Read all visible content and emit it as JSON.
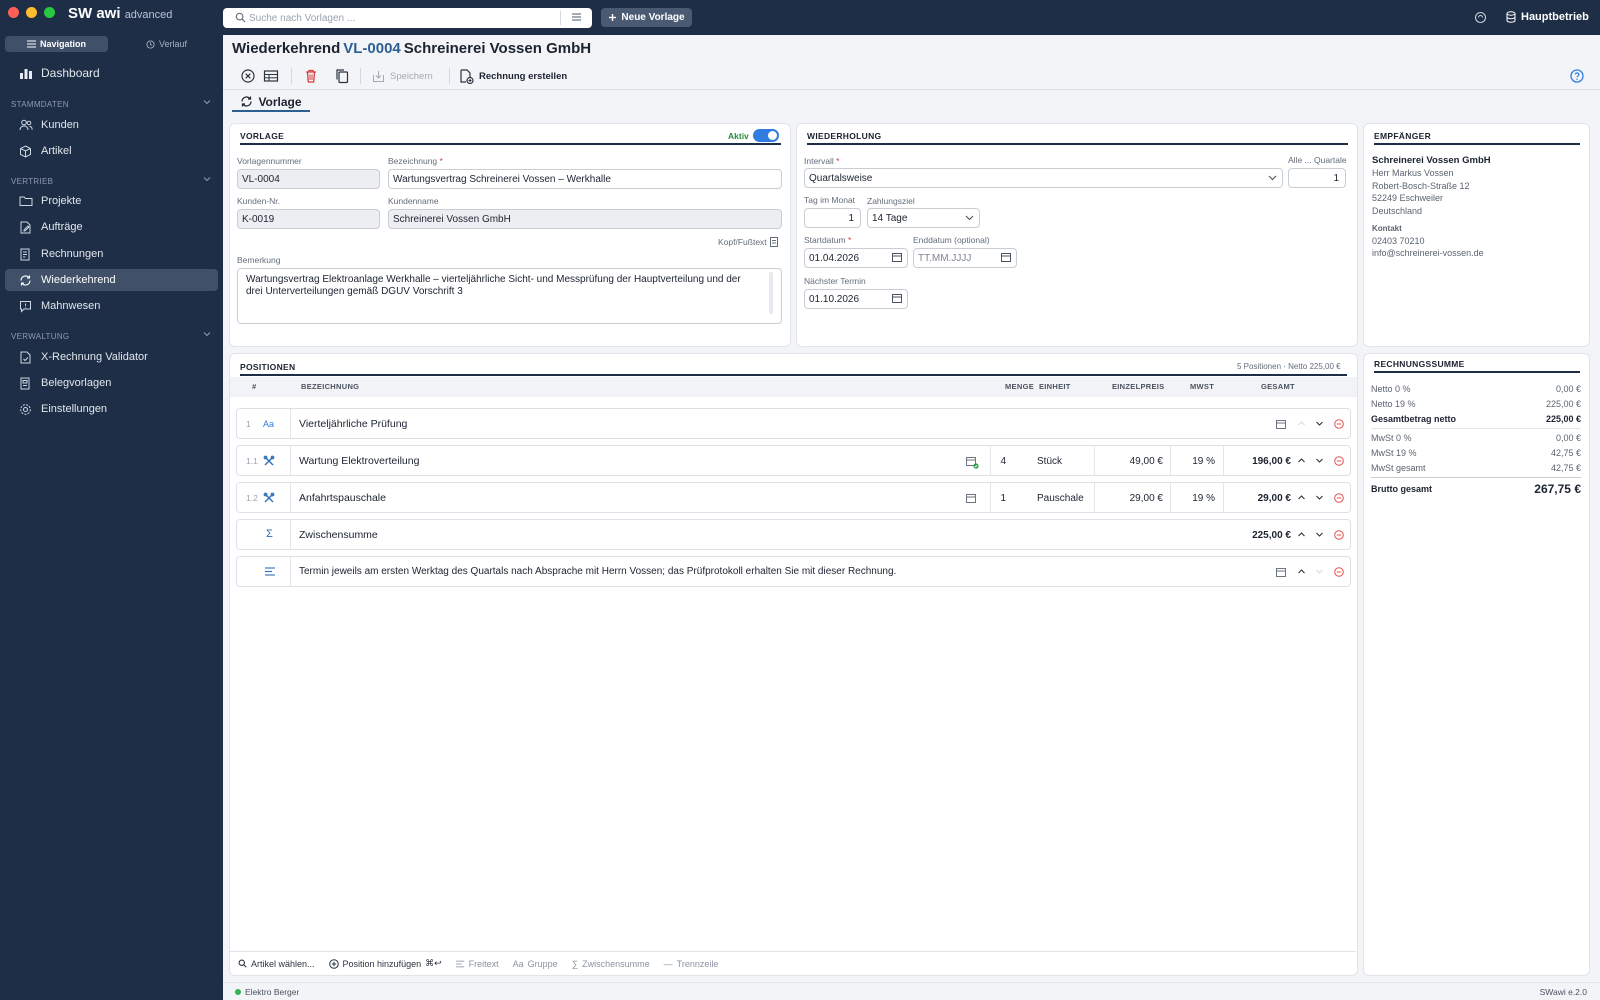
{
  "app": {
    "brand": "SW awi",
    "edition": "advanced",
    "version": "SWawi e.2.0"
  },
  "search": {
    "placeholder": "Suche nach Vorlagen ..."
  },
  "topbar": {
    "new_button": "Neue Vorlage",
    "company": "Hauptbetrieb"
  },
  "sidebar": {
    "tab_nav": "Navigation",
    "tab_history": "Verlauf",
    "dashboard": "Dashboard",
    "sections": {
      "stammdaten": "STAMMDATEN",
      "vertrieb": "VERTRIEB",
      "verwaltung": "VERWALTUNG"
    },
    "items": {
      "kunden": "Kunden",
      "artikel": "Artikel",
      "projekte": "Projekte",
      "auftraege": "Aufträge",
      "rechnungen": "Rechnungen",
      "wiederkehrend": "Wiederkehrend",
      "mahnwesen": "Mahnwesen",
      "xrechnung": "X-Rechnung Validator",
      "belegvorlagen": "Belegvorlagen",
      "einstellungen": "Einstellungen"
    }
  },
  "header": {
    "prefix": "Wiederkehrend",
    "number": "VL-0004",
    "customer": "Schreinerei Vossen GmbH"
  },
  "toolbar": {
    "save": "Speichern",
    "create_invoice": "Rechnung erstellen"
  },
  "tab": {
    "label": "Vorlage"
  },
  "vorlage": {
    "title": "VORLAGE",
    "active_label": "Aktiv",
    "active": true,
    "nr_label": "Vorlagennummer",
    "nr": "VL-0004",
    "bez_label": "Bezeichnung",
    "bez": "Wartungsvertrag Schreinerei Vossen – Werkhalle",
    "kdnr_label": "Kunden-Nr.",
    "kdnr": "K-0019",
    "kdname_label": "Kundenname",
    "kdname": "Schreinerei Vossen GmbH",
    "kopf": "Kopf/Fußtext",
    "bem_label": "Bemerkung",
    "bem": "Wartungsvertrag Elektroanlage Werkhalle – vierteljährliche Sicht- und Messprüfung der Hauptverteilung und der drei Unterverteilungen gemäß DGUV Vorschrift 3"
  },
  "wiederholung": {
    "title": "WIEDERHOLUNG",
    "intervall_label": "Intervall",
    "intervall": "Quartalsweise",
    "alle_label": "Alle ... Quartale",
    "alle": "1",
    "tag_label": "Tag im Monat",
    "tag": "1",
    "ziel_label": "Zahlungsziel",
    "ziel": "14 Tage",
    "start_label": "Startdatum",
    "start": "01.04.2026",
    "end_label": "Enddatum (optional)",
    "end_placeholder": "TT.MM.JJJJ",
    "next_label": "Nächster Termin",
    "next": "01.10.2026"
  },
  "empfaenger": {
    "title": "EMPFÄNGER",
    "name": "Schreinerei Vossen GmbH",
    "contact": "Herr Markus Vossen",
    "street": "Robert-Bosch-Straße 12",
    "city": "52249 Eschweiler",
    "country": "Deutschland",
    "kontakt_label": "Kontakt",
    "phone": "02403 70210",
    "email": "info@schreinerei-vossen.de"
  },
  "positionen": {
    "title": "POSITIONEN",
    "summary": "5 Positionen · Netto 225,00 €",
    "headers": {
      "nr": "#",
      "bez": "BEZEICHNUNG",
      "menge": "MENGE",
      "einheit": "EINHEIT",
      "preis": "EINZELPREIS",
      "mwst": "MWST",
      "gesamt": "GESAMT"
    },
    "rows": [
      {
        "nr": "1",
        "type": "Aa",
        "desc": "Vierteljährliche Prüfung"
      },
      {
        "nr": "1.1",
        "desc": "Wartung Elektroverteilung",
        "menge": "4",
        "einheit": "Stück",
        "preis": "49,00 €",
        "mwst": "19 %",
        "gesamt": "196,00 €"
      },
      {
        "nr": "1.2",
        "desc": "Anfahrtspauschale",
        "menge": "1",
        "einheit": "Pauschale",
        "preis": "29,00 €",
        "mwst": "19 %",
        "gesamt": "29,00 €"
      },
      {
        "type": "Σ",
        "desc": "Zwischensumme",
        "gesamt": "225,00 €"
      },
      {
        "desc": "Termin jeweils am ersten Werktag des Quartals nach Absprache mit Herrn Vossen; das Prüfprotokoll erhalten Sie mit dieser Rechnung."
      }
    ]
  },
  "summe": {
    "title": "RECHNUNGSSUMME",
    "netto0_label": "Netto 0 %",
    "netto0": "0,00 €",
    "netto19_label": "Netto 19 %",
    "netto19": "225,00 €",
    "gesamtnetto_label": "Gesamtbetrag netto",
    "gesamtnetto": "225,00 €",
    "mwst0_label": "MwSt 0 %",
    "mwst0": "0,00 €",
    "mwst19_label": "MwSt 19 %",
    "mwst19": "42,75 €",
    "mwstges_label": "MwSt gesamt",
    "mwstges": "42,75 €",
    "brutto_label": "Brutto gesamt",
    "brutto": "267,75 €"
  },
  "bottom": {
    "artikel": "Artikel wählen...",
    "position": "Position hinzufügen",
    "shortcut": "⌘↩",
    "freitext": "Freitext",
    "gruppe": "Gruppe",
    "zwischensumme": "Zwischensumme",
    "trennzeile": "Trennzeile"
  },
  "status": {
    "company": "Elektro Berger"
  },
  "colors": {
    "sidebar": "#1e2e46",
    "accent": "#2e5f93",
    "toggle": "#2f7de1",
    "delete": "#d93a3a",
    "online": "#2fb35b"
  }
}
